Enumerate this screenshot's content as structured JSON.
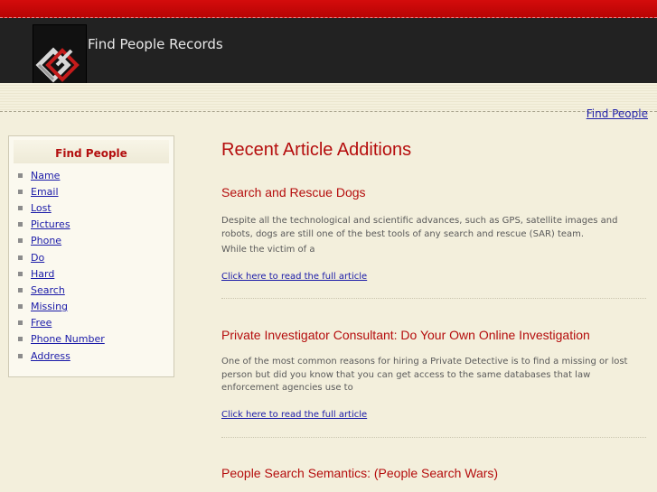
{
  "header": {
    "site_title": "Find People Records",
    "logo_icon": "site-logo-icon"
  },
  "top_link": "Find People",
  "sidebar": {
    "title": "Find People",
    "items": [
      {
        "label": "Name"
      },
      {
        "label": "Email"
      },
      {
        "label": "Lost"
      },
      {
        "label": "Pictures"
      },
      {
        "label": "Phone"
      },
      {
        "label": "Do"
      },
      {
        "label": "Hard"
      },
      {
        "label": "Search"
      },
      {
        "label": "Missing"
      },
      {
        "label": "Free"
      },
      {
        "label": "Phone Number"
      },
      {
        "label": "Address"
      }
    ]
  },
  "main": {
    "heading": "Recent Article Additions",
    "articles": [
      {
        "title": "Search and Rescue Dogs",
        "excerpt": "Despite all the technological and scientific advances, such as GPS, satellite images and robots, dogs are still one of the best tools of any search and rescue (SAR) team.",
        "excerpt2": "While the victim of a",
        "link": "Click here to read the full article"
      },
      {
        "title": "Private Investigator Consultant: Do Your Own Online Investigation",
        "excerpt": "One of the most common reasons for hiring a Private Detective is to find a missing or lost person but did you know that you can get access to the same databases that law enforcement agencies use to",
        "link": "Click here to read the full article"
      },
      {
        "title": "People Search Semantics: (People Search Wars)"
      }
    ]
  },
  "colors": {
    "accent_red": "#b50d0d",
    "header_dark": "#222222",
    "link_blue": "#1a1aa8",
    "page_bg": "#f3efdc"
  }
}
